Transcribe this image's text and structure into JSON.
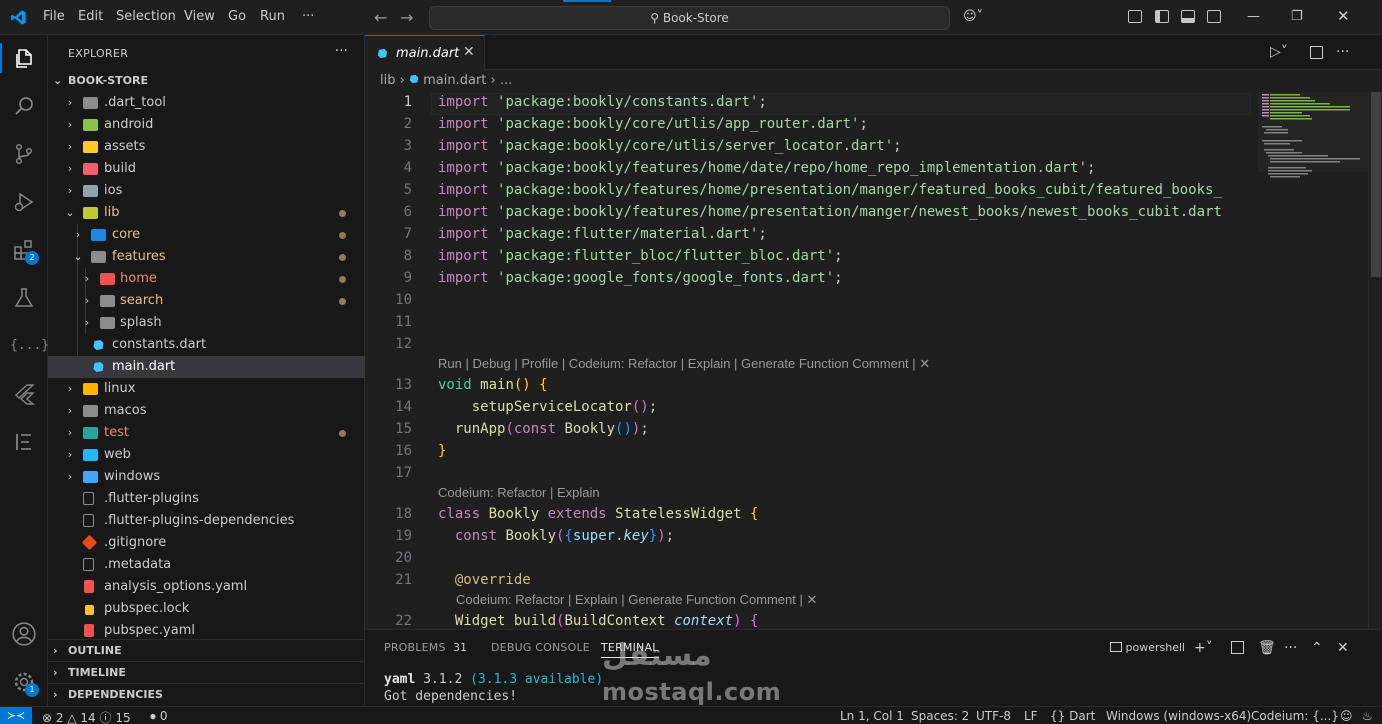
{
  "titlebar": {
    "menu": [
      "File",
      "Edit",
      "Selection",
      "View",
      "Go",
      "Run",
      "···"
    ],
    "search": "Book-Store",
    "copilot_icon": "copilot-icon"
  },
  "colors": {
    "accent": "#0078d4",
    "modified": "#e2c08d",
    "error": "#f48771",
    "string": "#a5d6a7",
    "keyword": "#c586c0"
  },
  "activitybar": {
    "icons": [
      "explorer-icon",
      "search-icon",
      "source-control-icon",
      "run-debug-icon",
      "extensions-icon",
      "testing-icon",
      "json-icon",
      "flutter-icon",
      "outline-list-icon",
      "account-icon",
      "settings-icon"
    ],
    "extensions_badge": "2",
    "settings_badge": "1",
    "json_label": "{...}"
  },
  "sidebar": {
    "title": "EXPLORER",
    "more": "···",
    "root": "BOOK-STORE",
    "tree": [
      {
        "label": ".dart_tool"
      },
      {
        "label": "android"
      },
      {
        "label": "assets"
      },
      {
        "label": "build"
      },
      {
        "label": "ios"
      },
      {
        "label": "lib"
      },
      {
        "label": "core"
      },
      {
        "label": "features"
      },
      {
        "label": "home"
      },
      {
        "label": "search"
      },
      {
        "label": "splash"
      },
      {
        "label": "constants.dart"
      },
      {
        "label": "main.dart"
      },
      {
        "label": "linux"
      },
      {
        "label": "macos"
      },
      {
        "label": "test"
      },
      {
        "label": "web"
      },
      {
        "label": "windows"
      },
      {
        "label": ".flutter-plugins"
      },
      {
        "label": ".flutter-plugins-dependencies"
      },
      {
        "label": ".gitignore"
      },
      {
        "label": ".metadata"
      },
      {
        "label": "analysis_options.yaml"
      },
      {
        "label": "pubspec.lock"
      },
      {
        "label": "pubspec.yaml"
      }
    ],
    "sections": [
      "OUTLINE",
      "TIMELINE",
      "DEPENDENCIES"
    ]
  },
  "editor": {
    "tab": "main.dart",
    "breadcrumb": [
      "lib",
      "main.dart",
      "..."
    ],
    "imports": [
      "'package:bookly/constants.dart'",
      "'package:bookly/core/utlis/app_router.dart'",
      "'package:bookly/core/utlis/server_locator.dart'",
      "'package:bookly/features/home/date/repo/home_repo_implementation.dart'",
      "'package:bookly/features/home/presentation/manger/featured_books_cubit/featured_books_",
      "'package:bookly/features/home/presentation/manger/newest_books/newest_books_cubit.dart",
      "'package:flutter/material.dart'",
      "'package:flutter_bloc/flutter_bloc.dart'",
      "'package:google_fonts/google_fonts.dart'"
    ],
    "import_kw": "import",
    "lens_main": "Run | Debug | Profile | Codeium: Refactor | Explain | Generate Function Comment | ✕",
    "lens_class": "Codeium: Refactor | Explain",
    "lens_build": "Codeium: Refactor | Explain | Generate Function Comment | ✕",
    "line_numbers": [
      "1",
      "2",
      "3",
      "4",
      "5",
      "6",
      "7",
      "8",
      "9",
      "10",
      "11",
      "12",
      "13",
      "14",
      "15",
      "16",
      "17",
      "18",
      "19",
      "20",
      "21",
      "22"
    ]
  },
  "panel": {
    "tabs": [
      "PROBLEMS",
      "DEBUG CONSOLE",
      "TERMINAL"
    ],
    "problems_count": "31",
    "shell": "powershell",
    "terminal_line1_pkg": "yaml",
    "terminal_line1_ver": " 3.1.2 ",
    "terminal_line1_avail": "(3.1.3 available)",
    "terminal_line2": "Got dependencies!"
  },
  "statusbar": {
    "errors": "2",
    "warnings": "14",
    "infos": "15",
    "ports": "0",
    "position": "Ln 1, Col 1",
    "spaces": "Spaces: 2",
    "encoding": "UTF-8",
    "eol": "LF",
    "language": "Dart",
    "device": "Windows (windows-x64)",
    "codeium": "Codeium: {...}"
  },
  "watermark": {
    "arabic": "مستقل",
    "latin": "mostaql.com"
  }
}
